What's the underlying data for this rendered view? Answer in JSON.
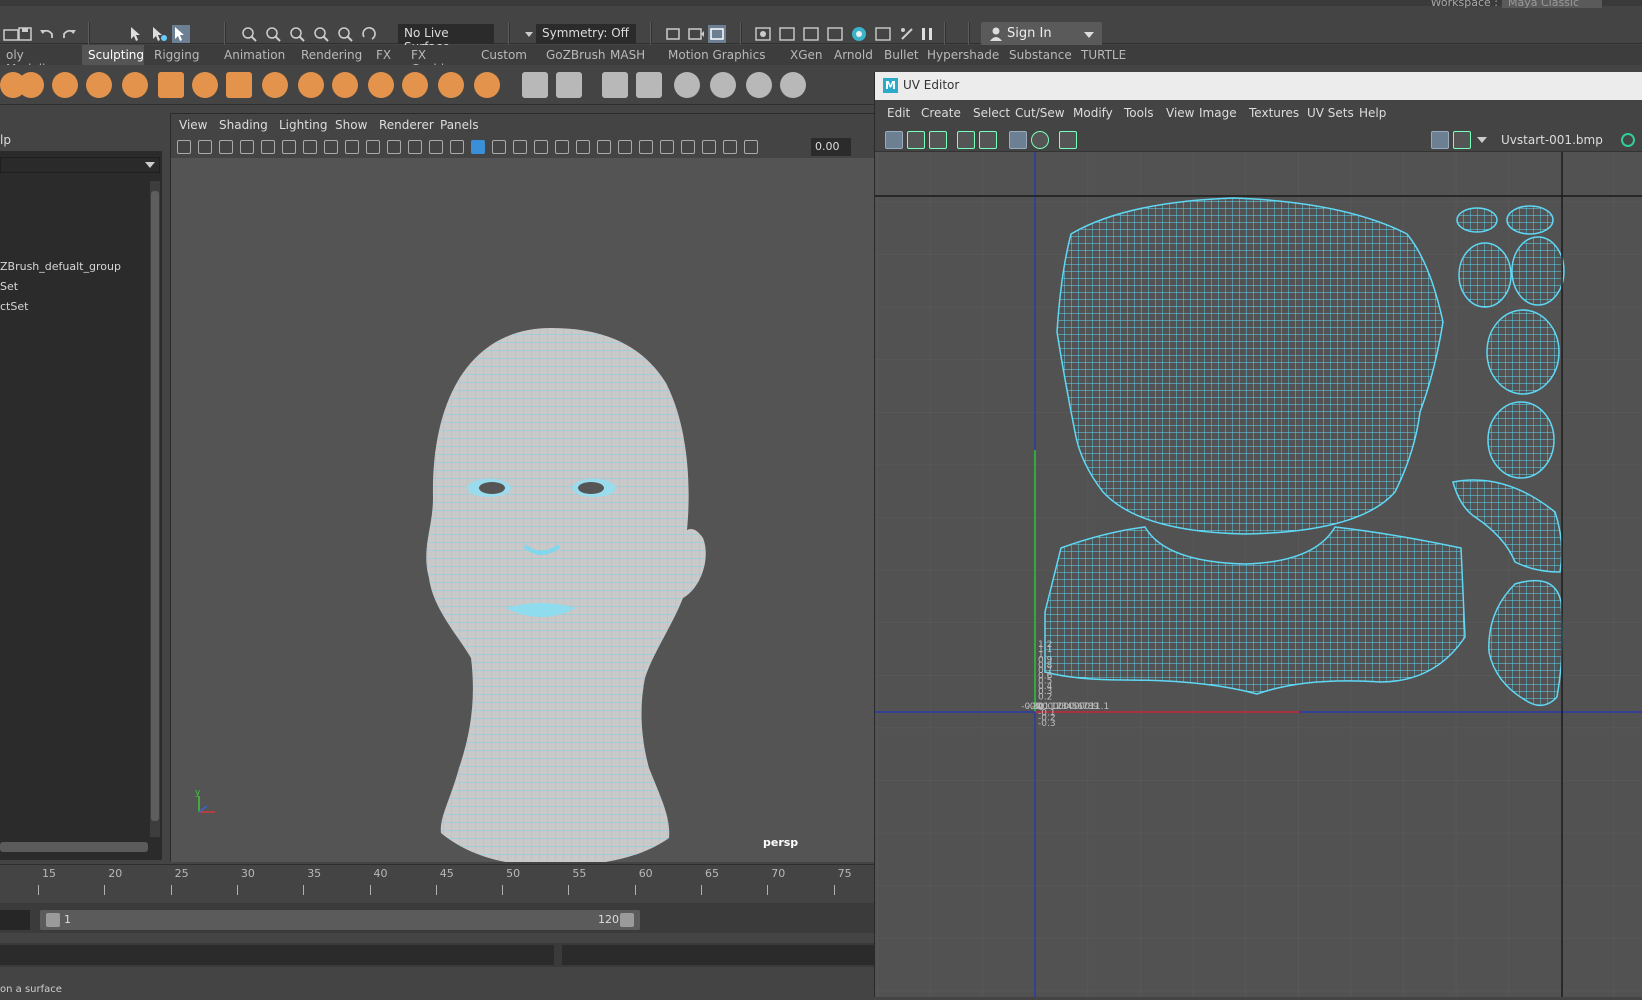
{
  "workspace": {
    "label": "Workspace :",
    "value": "Maya Classic"
  },
  "status_line": {
    "live_surface": "No Live Surface",
    "symmetry": "Symmetry: Off",
    "sign_in": "Sign In"
  },
  "shelf_tabs": [
    "oly Modeling",
    "Sculpting",
    "Rigging",
    "Animation",
    "Rendering",
    "FX",
    "FX Caching",
    "Custom",
    "GoZBrush",
    "MASH",
    "Motion Graphics",
    "XGen",
    "Arnold",
    "Bullet",
    "Hypershade",
    "Substance",
    "TURTLE"
  ],
  "active_shelf_tab": "Sculpting",
  "outliner": {
    "header": "lp",
    "items": [
      "ZBrush_defualt_group",
      "Set",
      "ctSet"
    ]
  },
  "viewport": {
    "menus": [
      "View",
      "Shading",
      "Lighting",
      "Show",
      "Renderer",
      "Panels"
    ],
    "field_value": "0.00",
    "camera_label": "persp",
    "axis_label": "y"
  },
  "timeline": {
    "ticks": [
      "15",
      "20",
      "25",
      "30",
      "35",
      "40",
      "45",
      "50",
      "55",
      "60",
      "65",
      "70",
      "75"
    ],
    "range_start": "1",
    "range_end": "120"
  },
  "help_line": "on a surface",
  "uv_editor": {
    "title": "UV Editor",
    "logo": "M",
    "menus": [
      "Edit",
      "Create",
      "Select",
      "Cut/Sew",
      "Modify",
      "Tools",
      "View",
      "Image",
      "Textures",
      "UV Sets",
      "Help"
    ],
    "image_name": "Uvstart-001.bmp",
    "v_ticks": [
      "1.2",
      "1.1",
      "1",
      "0.9",
      "0.8",
      "0.7",
      "0.6",
      "0.5",
      "0.4",
      "0.3",
      "0.2",
      "0",
      "-0.1",
      "-0.2",
      "-0.3"
    ],
    "u_ticks": [
      "-0.3",
      "-0.2",
      "-0.1",
      "0",
      "0.1",
      "0.2",
      "0.3",
      "0.4",
      "0.5",
      "0.6",
      "0.7",
      "0.8",
      "0.9",
      "1",
      "1.1"
    ]
  },
  "colors": {
    "wire": "#5fd8f5",
    "mesh_fill": "#c9c9c9",
    "accent_icon": "#e3934b",
    "u_axis": "#cc2a2a",
    "v_axis": "#2ecc2e",
    "axis_blue": "#2a3aaa"
  }
}
